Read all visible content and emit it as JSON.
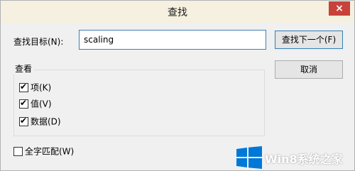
{
  "window": {
    "title": "查找",
    "close_glyph": "×"
  },
  "find": {
    "label": "查找目标(N):",
    "value": "scaling",
    "find_next_label": "查找下一个(F)",
    "cancel_label": "取消"
  },
  "look_in": {
    "title": "查看",
    "options": [
      {
        "label": "项(K)",
        "checked": true
      },
      {
        "label": "值(V)",
        "checked": true
      },
      {
        "label": "数据(D)",
        "checked": true
      }
    ]
  },
  "match_whole_word": {
    "label": "全字匹配(W)",
    "checked": false
  },
  "watermark": {
    "text": "Win8系统之家",
    "color": "#0078d7"
  },
  "icons": {
    "close": "close-icon",
    "checkmark": "checkmark-icon",
    "logo": "windows-logo-icon"
  }
}
